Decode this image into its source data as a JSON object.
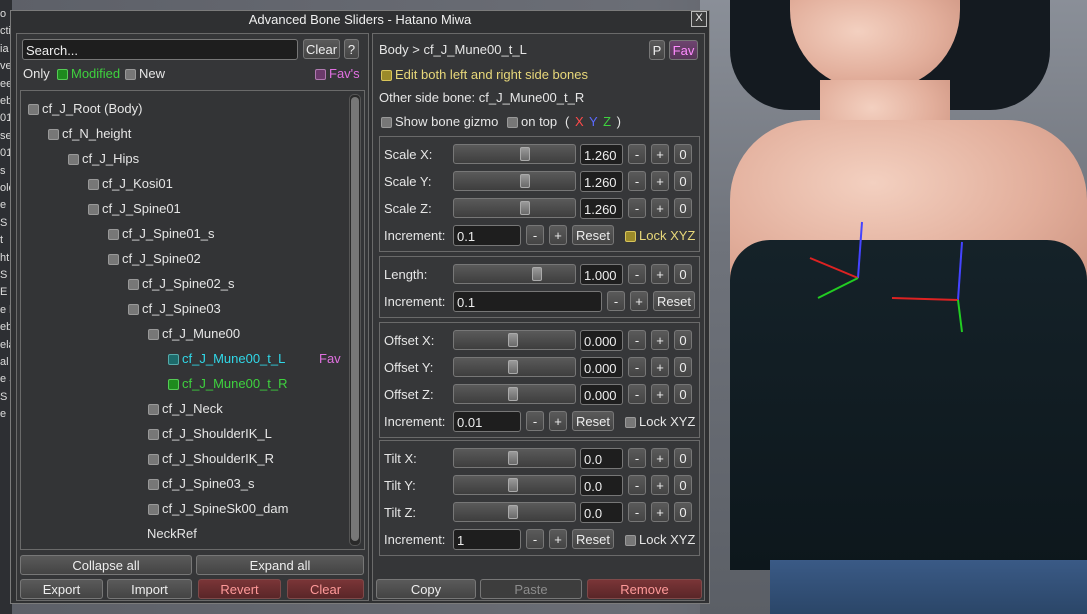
{
  "window": {
    "title": "Advanced Bone Sliders - Hatano Miwa",
    "close": "X"
  },
  "left": {
    "search_placeholder": "Search...",
    "clear": "Clear",
    "help": "?",
    "only": "Only",
    "modified": "Modified",
    "new": "New",
    "favs": "Fav's",
    "tree": [
      {
        "label": "cf_J_Root (Body)",
        "depth": 0,
        "color": "#e6e6e6",
        "check": true
      },
      {
        "label": "cf_N_height",
        "depth": 1,
        "color": "#e6e6e6",
        "check": true
      },
      {
        "label": "cf_J_Hips",
        "depth": 2,
        "color": "#e6e6e6",
        "check": true
      },
      {
        "label": "cf_J_Kosi01",
        "depth": 3,
        "color": "#e6e6e6",
        "check": true
      },
      {
        "label": "cf_J_Spine01",
        "depth": 3,
        "color": "#e6e6e6",
        "check": true
      },
      {
        "label": "cf_J_Spine01_s",
        "depth": 4,
        "color": "#e6e6e6",
        "check": true
      },
      {
        "label": "cf_J_Spine02",
        "depth": 4,
        "color": "#e6e6e6",
        "check": true
      },
      {
        "label": "cf_J_Spine02_s",
        "depth": 5,
        "color": "#e6e6e6",
        "check": true
      },
      {
        "label": "cf_J_Spine03",
        "depth": 5,
        "color": "#e6e6e6",
        "check": true
      },
      {
        "label": "cf_J_Mune00",
        "depth": 6,
        "color": "#e6e6e6",
        "check": true
      },
      {
        "label": "cf_J_Mune00_t_L",
        "depth": 7,
        "color": "#30d8e8",
        "check": true,
        "fav": "Fav"
      },
      {
        "label": "cf_J_Mune00_t_R",
        "depth": 7,
        "color": "#3ed23e",
        "check": true
      },
      {
        "label": "cf_J_Neck",
        "depth": 6,
        "color": "#e6e6e6",
        "check": true
      },
      {
        "label": "cf_J_ShoulderIK_L",
        "depth": 6,
        "color": "#e6e6e6",
        "check": true
      },
      {
        "label": "cf_J_ShoulderIK_R",
        "depth": 6,
        "color": "#e6e6e6",
        "check": true
      },
      {
        "label": "cf_J_Spine03_s",
        "depth": 6,
        "color": "#e6e6e6",
        "check": true
      },
      {
        "label": "cf_J_SpineSk00_dam",
        "depth": 6,
        "color": "#e6e6e6",
        "check": true
      },
      {
        "label": "NeckRef",
        "depth": 6,
        "color": "#e6e6e6",
        "check": false
      }
    ],
    "collapse_all": "Collapse all",
    "expand_all": "Expand all",
    "export": "Export",
    "import": "Import",
    "revert": "Revert",
    "clear_bottom": "Clear"
  },
  "right": {
    "breadcrumb": "Body > cf_J_Mune00_t_L",
    "p": "P",
    "fav": "Fav",
    "edit_both": "Edit both left and right side bones",
    "other_side": "Other side bone: cf_J_Mune00_t_R",
    "show_gizmo": "Show bone gizmo",
    "on_top": "on top",
    "paren_open": "(",
    "x": "X",
    "y": "Y",
    "z": "Z",
    "paren_close": ")",
    "scale": {
      "rows": [
        {
          "label": "Scale X:",
          "value": "1.260",
          "pos": 0.58
        },
        {
          "label": "Scale Y:",
          "value": "1.260",
          "pos": 0.58
        },
        {
          "label": "Scale Z:",
          "value": "1.260",
          "pos": 0.58
        }
      ],
      "increment_label": "Increment:",
      "increment": "0.1",
      "lock": "Lock XYZ"
    },
    "length": {
      "rows": [
        {
          "label": "Length:",
          "value": "1.000",
          "pos": 0.69
        }
      ],
      "increment_label": "Increment:",
      "increment": "0.1"
    },
    "offset": {
      "rows": [
        {
          "label": "Offset X:",
          "value": "0.000",
          "pos": 0.48
        },
        {
          "label": "Offset Y:",
          "value": "0.000",
          "pos": 0.48
        },
        {
          "label": "Offset Z:",
          "value": "0.000",
          "pos": 0.48
        }
      ],
      "increment_label": "Increment:",
      "increment": "0.01",
      "lock": "Lock XYZ"
    },
    "tilt": {
      "rows": [
        {
          "label": "Tilt X:",
          "value": "0.0",
          "pos": 0.48
        },
        {
          "label": "Tilt Y:",
          "value": "0.0",
          "pos": 0.48
        },
        {
          "label": "Tilt Z:",
          "value": "0.0",
          "pos": 0.48
        }
      ],
      "increment_label": "Increment:",
      "increment": "1",
      "lock": "Lock XYZ"
    },
    "minus": "-",
    "plus": "+",
    "zero": "0",
    "reset": "Reset",
    "copy": "Copy",
    "paste": "Paste",
    "remove": "Remove"
  },
  "sidebar_fragments": [
    "o",
    "cti",
    "ia",
    "ve",
    "ee",
    "eb",
    "01",
    "se",
    "01",
    "s",
    "ole",
    "e",
    "S",
    "t",
    "ht",
    "S",
    "E",
    "e l",
    "eb",
    "ela",
    "al",
    "e S",
    "S",
    "e"
  ]
}
